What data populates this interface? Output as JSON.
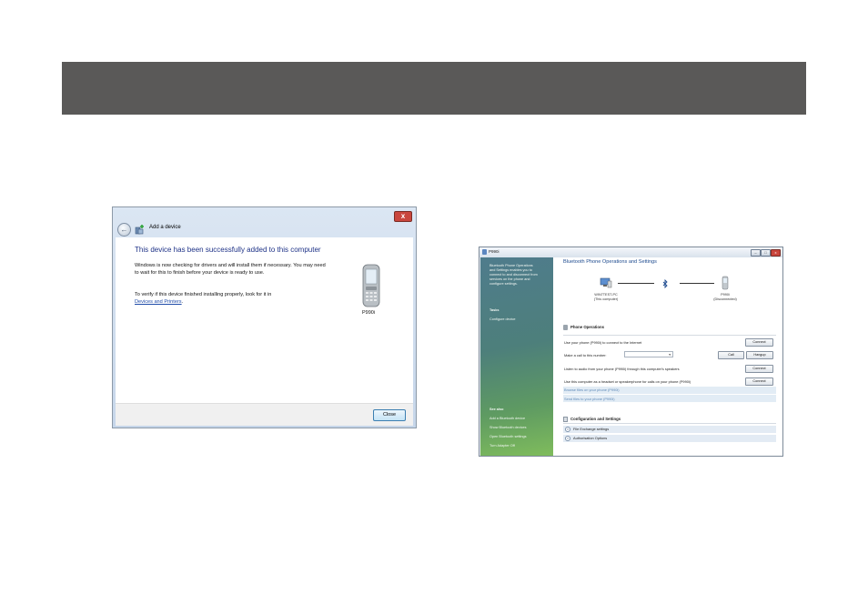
{
  "colors": {
    "banner": "#5a5958",
    "heading_blue": "#1e3287",
    "sidebar_green": "#5e9a62",
    "link_blue": "#1f4ba8"
  },
  "dialog_add_device": {
    "title": "Add a device",
    "heading": "This device has been successfully added to this computer",
    "paragraph1": "Windows is now checking for drivers and will install them if necessary. You may need to wait for this to finish before your device is ready to use.",
    "paragraph2_prefix": "To verify if this device finished installing properly, look for it in",
    "paragraph2_link": "Devices and Printers",
    "paragraph2_suffix": ".",
    "device_label": "P990i",
    "close_button": "Close",
    "icons": [
      "back-arrow-icon",
      "add-device-icon",
      "phone-icon",
      "close-icon"
    ]
  },
  "dialog_bluetooth": {
    "title": "P990i",
    "window_buttons": {
      "minimize": "–",
      "maximize": "□",
      "close": "x"
    },
    "sidebar": {
      "description": [
        "Bluetooth Phone Operations",
        "and Settings enables you to",
        "connect to and disconnect from",
        "services on the phone and",
        "configure settings."
      ],
      "tasks_heading": "Tasks",
      "tasks": [
        "Configure device"
      ],
      "see_also_heading": "See also",
      "see_also": [
        "Add a Bluetooth device",
        "Show Bluetooth devices",
        "Open Bluetooth settings",
        "Turn Adapter Off"
      ]
    },
    "main_title": "Bluetooth Phone Operations and Settings",
    "computer": {
      "name": "WIN7TEST-PC",
      "status": "(This computer)"
    },
    "phone": {
      "name": "P990i",
      "status": "(Disconnected)"
    },
    "phone_operations_heading": "Phone Operations",
    "rows": [
      {
        "text": "Use your phone (P990i) to connect to the Internet",
        "button": "Connect"
      },
      {
        "text": "Make a call to this number:",
        "button": "Call",
        "button2": "Hangup"
      },
      {
        "text": "Listen to audio from your phone (P990i) through this computer's speakers",
        "button": "Connect"
      },
      {
        "text": "Use this computer as a headset or speakerphone for calls on your phone (P990i)",
        "button": "Connect"
      }
    ],
    "links": [
      "Browse files on your phone (P990i)",
      "Send files to your phone (P990i)"
    ],
    "config_heading": "Configuration and Settings",
    "expanders": [
      "File Exchange settings",
      "Authorisation Options"
    ]
  }
}
